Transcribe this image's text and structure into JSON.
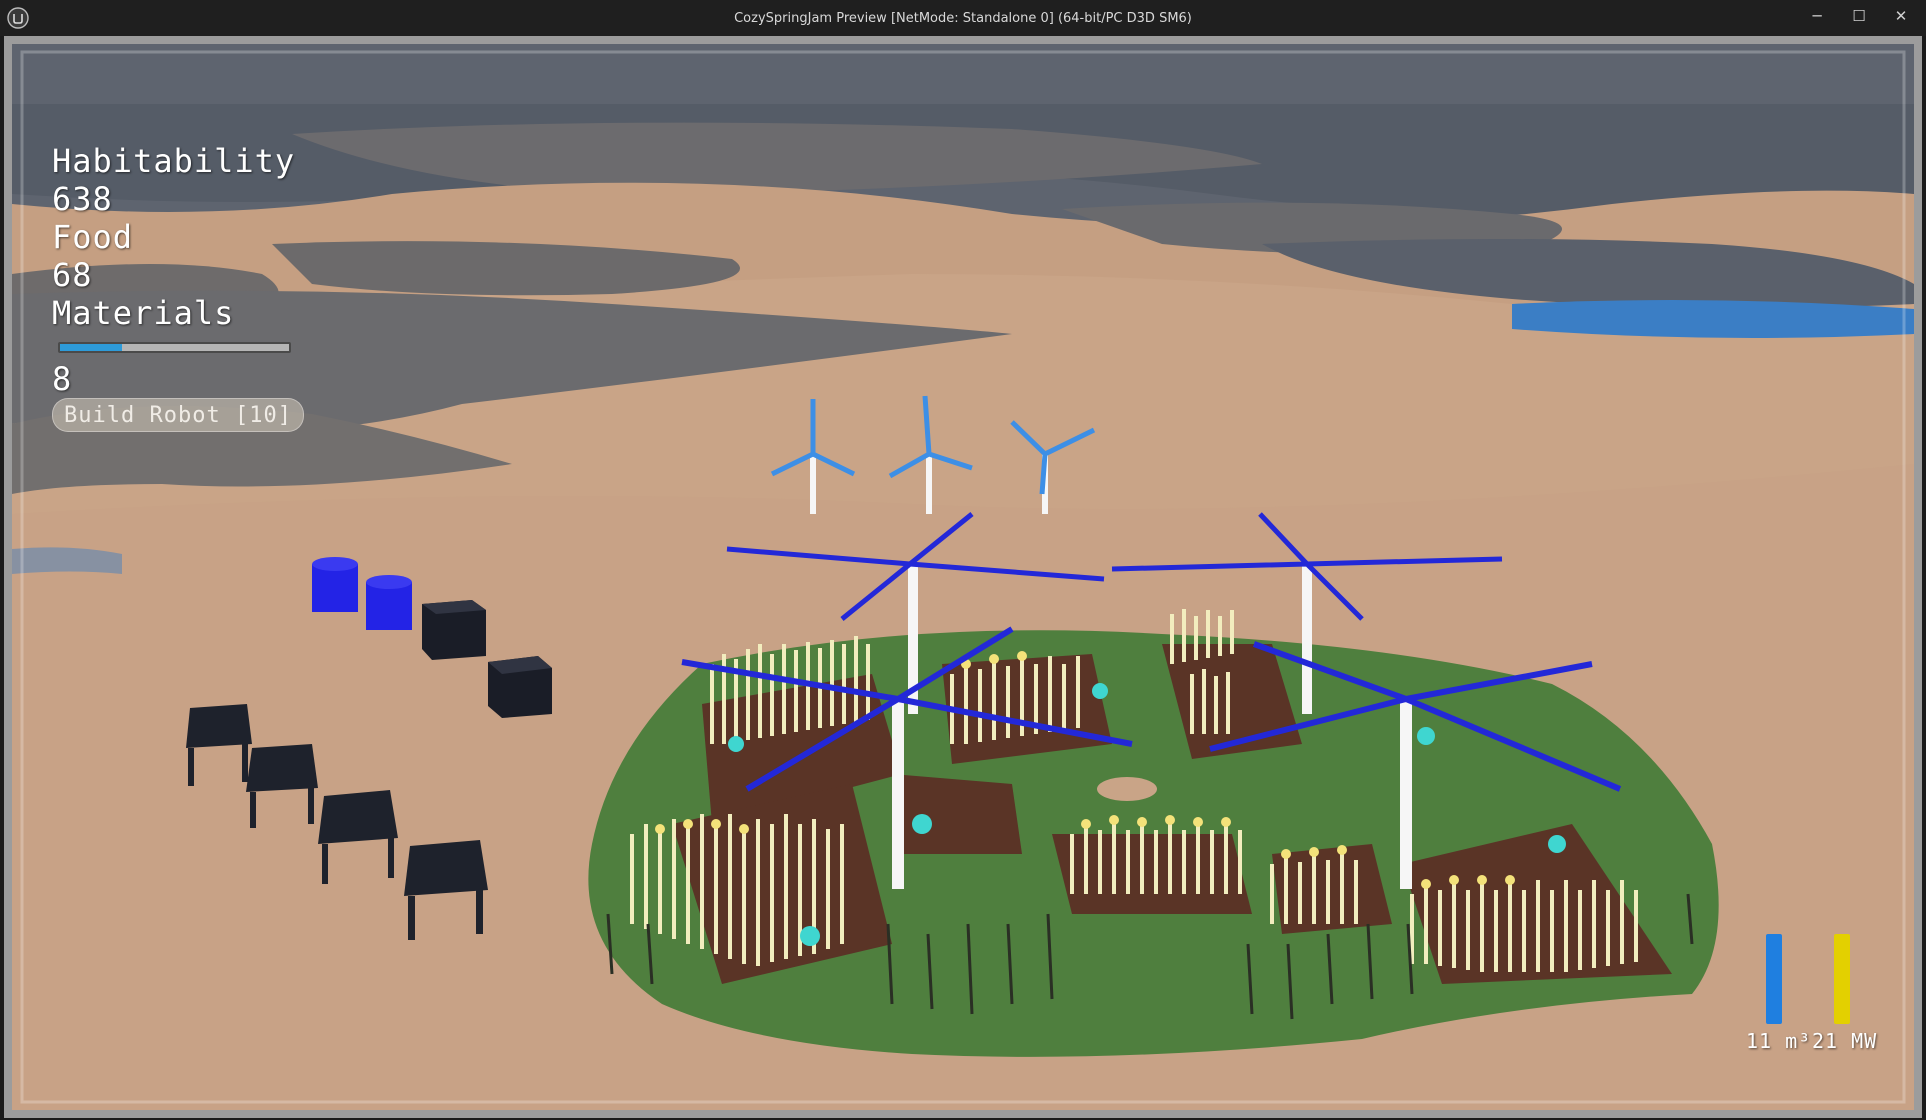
{
  "window": {
    "title": "CozySpringJam Preview [NetMode: Standalone 0]  (64-bit/PC D3D SM6)",
    "minimize_glyph": "─",
    "maximize_glyph": "☐",
    "close_glyph": "✕"
  },
  "hud": {
    "habitability_label": "Habitability",
    "habitability_value": "638",
    "food_label": "Food",
    "food_value": "68",
    "materials_label": "Materials",
    "materials_progress": 0.27,
    "materials_value": "8",
    "build_button_label": "Build Robot [10]"
  },
  "gauges": {
    "water": {
      "label": "11 m³",
      "fill": 0.8,
      "color": "#1f7fe0"
    },
    "power": {
      "label": "21 MW",
      "fill": 0.8,
      "color": "#e3d000"
    }
  },
  "colors": {
    "sand": "#c9a487",
    "water": "#5b6678",
    "grass": "#4f7f3e",
    "soil": "#5a3426",
    "turbine_blue": "#2328d8"
  },
  "icons": {
    "app_logo": "unreal-logo-icon"
  }
}
